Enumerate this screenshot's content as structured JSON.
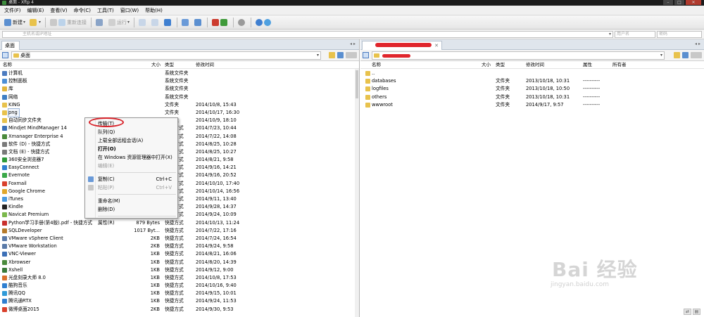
{
  "window": {
    "title": "桌面 - Xftp 4"
  },
  "menu": [
    "文件(F)",
    "编辑(E)",
    "查看(V)",
    "命令(C)",
    "工具(T)",
    "窗口(W)",
    "帮助(H)"
  ],
  "toolbar": {
    "new": "新建",
    "reconnect": "重新连接",
    "run": "运行"
  },
  "address": {
    "host_placeholder": "主机名或IP地址",
    "user_placeholder": "用户名",
    "password_placeholder": "密码"
  },
  "left": {
    "tab": "桌面",
    "path": "桌面",
    "columns": {
      "name": "名称",
      "size": "大小",
      "type": "类型",
      "modified": "修改时间"
    },
    "rows": [
      {
        "name": "计算机",
        "size": "",
        "type": "系统文件夹",
        "modified": "",
        "color": "#4b7bc0"
      },
      {
        "name": "控制面板",
        "size": "",
        "type": "系统文件夹",
        "modified": "",
        "color": "#4d8fd6"
      },
      {
        "name": "库",
        "size": "",
        "type": "系统文件夹",
        "modified": "",
        "color": "#e2b53c"
      },
      {
        "name": "网络",
        "size": "",
        "type": "系统文件夹",
        "modified": "",
        "color": "#3f7fc4"
      },
      {
        "name": "KING",
        "size": "",
        "type": "文件夹",
        "modified": "2014/10/8, 15:43",
        "color": "#e8c24c"
      },
      {
        "name": "png",
        "size": "",
        "type": "文件夹",
        "modified": "2014/10/17, 16:30",
        "color": "#e8c24c"
      },
      {
        "name": "自动同步文件夹",
        "size": "",
        "type": "文件夹",
        "modified": "2014/10/9, 18:10",
        "color": "#e8c24c"
      },
      {
        "name": "Mindjet MindManager 14",
        "size": "",
        "type": "快捷方式",
        "modified": "2014/7/23, 10:44",
        "color": "#3b6fb6"
      },
      {
        "name": "Xmanager Enterprise 4",
        "size": "",
        "type": "快捷方式",
        "modified": "2014/7/22, 14:08",
        "color": "#4a8a3c"
      },
      {
        "name": "软件 (D) - 快捷方式",
        "size": "",
        "type": "快捷方式",
        "modified": "2014/8/25, 10:28",
        "color": "#7a7a7a"
      },
      {
        "name": "文档 (E) - 快捷方式",
        "size": "",
        "type": "快捷方式",
        "modified": "2014/8/25, 10:27",
        "color": "#7a7a7a"
      },
      {
        "name": "360安全浏览器7",
        "size": "",
        "type": "快捷方式",
        "modified": "2014/8/21, 9:58",
        "color": "#2f9a3a"
      },
      {
        "name": "EasyConnect",
        "size": "",
        "type": "快捷方式",
        "modified": "2014/9/16, 14:21",
        "color": "#2f7fd0"
      },
      {
        "name": "Evernote",
        "size": "",
        "type": "快捷方式",
        "modified": "2014/9/16, 20:52",
        "color": "#3aa848"
      },
      {
        "name": "Foxmail",
        "size": "",
        "type": "快捷方式",
        "modified": "2014/10/10, 17:40",
        "color": "#d9402c"
      },
      {
        "name": "Google Chrome",
        "size": "",
        "type": "快捷方式",
        "modified": "2014/10/14, 16:56",
        "color": "#e0a72a"
      },
      {
        "name": "iTunes",
        "size": "",
        "type": "快捷方式",
        "modified": "2014/9/11, 13:40",
        "color": "#4a9be0"
      },
      {
        "name": "Kindle",
        "size": "",
        "type": "快捷方式",
        "modified": "2014/9/28, 14:37",
        "color": "#222222"
      },
      {
        "name": "Navicat Premium",
        "size": "",
        "type": "快捷方式",
        "modified": "2014/9/24, 10:09",
        "color": "#7bb84c"
      },
      {
        "name": "Python学习手册(第4版).pdf - 快捷方式",
        "size": "879 Bytes",
        "type": "快捷方式",
        "modified": "2014/10/13, 11:24",
        "color": "#c9302c"
      },
      {
        "name": "SQLDeveloper",
        "size": "1017 Byt...",
        "type": "快捷方式",
        "modified": "2014/7/22, 17:16",
        "color": "#b57a2a"
      },
      {
        "name": "VMware vSphere Client",
        "size": "2KB",
        "type": "快捷方式",
        "modified": "2014/7/24, 16:54",
        "color": "#5a7aa8"
      },
      {
        "name": "VMware Workstation",
        "size": "2KB",
        "type": "快捷方式",
        "modified": "2014/9/24, 9:58",
        "color": "#5a7aa8"
      },
      {
        "name": "VNC-Viewer",
        "size": "1KB",
        "type": "快捷方式",
        "modified": "2014/8/21, 16:06",
        "color": "#3b6fb6"
      },
      {
        "name": "Xbrowser",
        "size": "1KB",
        "type": "快捷方式",
        "modified": "2014/8/20, 14:39",
        "color": "#4a8a3c"
      },
      {
        "name": "Xshell",
        "size": "1KB",
        "type": "快捷方式",
        "modified": "2014/9/12, 9:00",
        "color": "#3a7a3a"
      },
      {
        "name": "光盘刻录大师 8.0",
        "size": "1KB",
        "type": "快捷方式",
        "modified": "2014/10/8, 17:53",
        "color": "#d9702c"
      },
      {
        "name": "酷狗音乐",
        "size": "1KB",
        "type": "快捷方式",
        "modified": "2014/10/16, 9:40",
        "color": "#2f7fd0"
      },
      {
        "name": "腾讯QQ",
        "size": "1KB",
        "type": "快捷方式",
        "modified": "2014/9/15, 10:01",
        "color": "#2f9ad8"
      },
      {
        "name": "腾讯通RTX",
        "size": "1KB",
        "type": "快捷方式",
        "modified": "2014/9/24, 11:53",
        "color": "#2f7fd0"
      },
      {
        "name": "微博桌面2015",
        "size": "2KB",
        "type": "快捷方式",
        "modified": "2014/9/30, 9:53",
        "color": "#d9402c"
      }
    ]
  },
  "right": {
    "columns": {
      "name": "名称",
      "size": "大小",
      "type": "类型",
      "modified": "修改时间",
      "attributes": "属性",
      "owner": "所有者"
    },
    "rows": [
      {
        "name": "..",
        "type": "",
        "modified": "",
        "attributes": ""
      },
      {
        "name": "databases",
        "type": "文件夹",
        "modified": "2013/10/18, 10:31",
        "attributes": "----------"
      },
      {
        "name": "logfiles",
        "type": "文件夹",
        "modified": "2013/10/18, 10:50",
        "attributes": "----------"
      },
      {
        "name": "others",
        "type": "文件夹",
        "modified": "2013/10/18, 10:31",
        "attributes": "----------"
      },
      {
        "name": "wwwroot",
        "type": "文件夹",
        "modified": "2014/9/17, 9:57",
        "attributes": "----------"
      }
    ]
  },
  "context_menu": {
    "transfer": "传输(T)",
    "queue": "队列(Q)",
    "upload_all": "上载全部远程会话(A)",
    "open": "打开(O)",
    "open_explorer": "在 Windows 资源管理器中打开(X)",
    "edit": "编辑(E)",
    "copy": "复制(C)",
    "copy_shortcut": "Ctrl+C",
    "paste": "粘贴(P)",
    "paste_shortcut": "Ctrl+V",
    "rename": "重命名(M)",
    "delete": "删除(D)",
    "properties": "属性(R)"
  },
  "watermark": {
    "brand": "Bai 经验",
    "url": "jingyan.baidu.com"
  }
}
